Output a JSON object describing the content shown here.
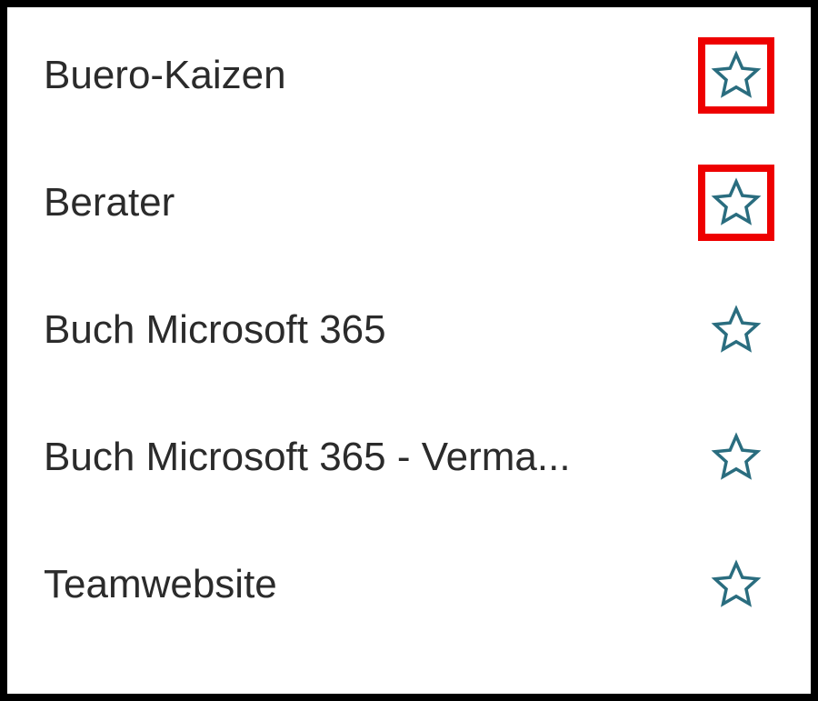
{
  "list": {
    "items": [
      {
        "label": "Buero-Kaizen",
        "highlighted": true
      },
      {
        "label": "Berater",
        "highlighted": true
      },
      {
        "label": "Buch Microsoft 365",
        "highlighted": false
      },
      {
        "label": "Buch Microsoft 365 - Verma...",
        "highlighted": false
      },
      {
        "label": "Teamwebsite",
        "highlighted": false
      }
    ]
  },
  "colors": {
    "star_stroke": "#2a6d7f",
    "highlight_border": "#ee0000"
  }
}
